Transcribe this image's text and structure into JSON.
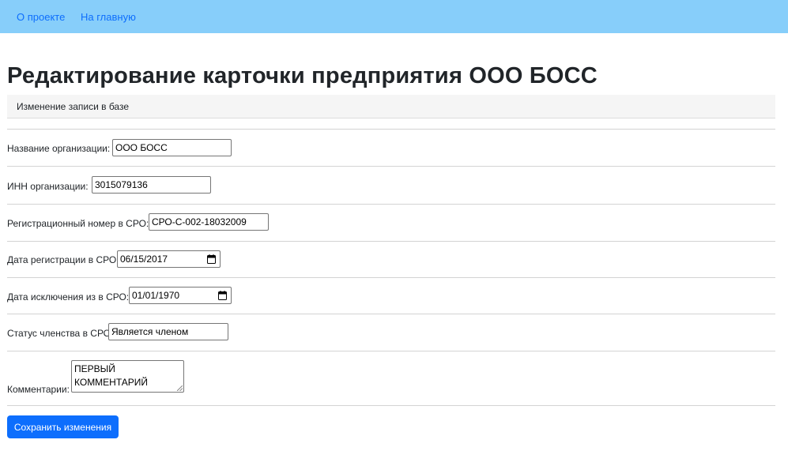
{
  "nav": {
    "about": "О проекте",
    "home": "На главную"
  },
  "page": {
    "title": "Редактирование карточки предприятия ООО БОСС",
    "breadcrumb": "Изменение записи в базе"
  },
  "form": {
    "name": {
      "label": "Название организации:",
      "value": "ООО БОСС"
    },
    "inn": {
      "label": "ИНН организации:",
      "value": "3015079136"
    },
    "sro_number": {
      "label": "Регистрационный номер в СРО:",
      "value": "СРО-С-002-18032009"
    },
    "sro_reg_date": {
      "label": "Дата регистрации в СРО:",
      "value": "06/15/2017"
    },
    "sro_exclusion_date": {
      "label": "Дата исключения из в СРО:",
      "value": "01/01/1970"
    },
    "membership_status": {
      "label": "Статус членства в СРО:",
      "value": "Является членом"
    },
    "comments": {
      "label": "Комментарии:",
      "value": "ПЕРВЫЙ КОММЕНТАРИЙ"
    },
    "save_label": "Сохранить изменения"
  },
  "colors": {
    "navbar_bg": "#87cefa",
    "link": "#0d6efd",
    "primary_button": "#0d6efd"
  },
  "icons": {
    "date_picker": "calendar-icon",
    "textarea_resize": "resize-handle-icon"
  }
}
